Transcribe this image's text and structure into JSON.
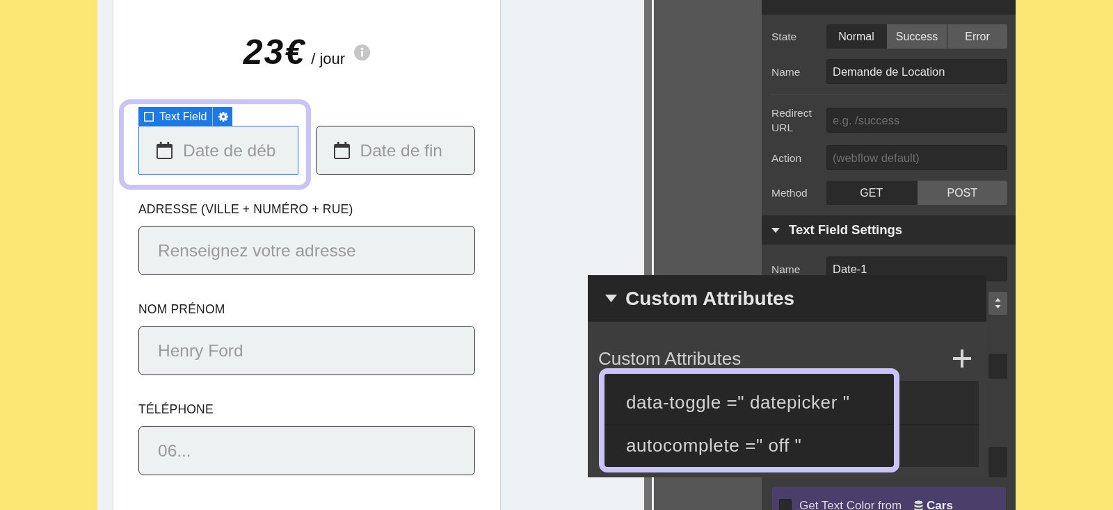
{
  "form": {
    "price": {
      "amount": "23€",
      "unit": "/ jour"
    },
    "date_fields": [
      {
        "placeholder": "Date de déb",
        "selected": true
      },
      {
        "placeholder": "Date de fin",
        "selected": false
      }
    ],
    "selection_badge": {
      "label": "Text Field"
    },
    "fields": [
      {
        "label": "ADRESSE (VILLE + NUMÉRO + RUE)",
        "placeholder": "Renseignez votre adresse"
      },
      {
        "label": "NOM PRÉNOM",
        "placeholder": "Henry Ford"
      },
      {
        "label": "TÉLÉPHONE",
        "placeholder": "06..."
      }
    ]
  },
  "settings": {
    "form_settings": {
      "groups": [
        {
          "rows": [
            {
              "kind": "segmented",
              "label": "State",
              "options": [
                {
                  "label": "Normal",
                  "selected": true
                },
                {
                  "label": "Success",
                  "selected": false
                },
                {
                  "label": "Error",
                  "selected": false
                }
              ]
            },
            {
              "kind": "input",
              "label": "Name",
              "value": "Demande de Location"
            }
          ]
        },
        {
          "rows": [
            {
              "kind": "input",
              "label": "Redirect URL",
              "placeholder": "e.g. /success"
            },
            {
              "kind": "input",
              "label": "Action",
              "placeholder": "(webflow default)"
            },
            {
              "kind": "segmented",
              "label": "Method",
              "options": [
                {
                  "label": "GET",
                  "selected": true
                },
                {
                  "label": "POST",
                  "selected": false
                }
              ]
            }
          ]
        }
      ]
    },
    "text_field_settings": {
      "title": "Text Field Settings",
      "rows": [
        {
          "kind": "input",
          "label": "Name",
          "value": "Date-1"
        }
      ]
    },
    "color_binding": {
      "checked": false,
      "label": "Get Text Color from",
      "source": "Cars"
    }
  },
  "custom_attributes": {
    "title": "Custom Attributes",
    "label": "Custom Attributes",
    "attributes": [
      "data-toggle =\" datepicker \"",
      "autocomplete =\" off \""
    ]
  }
}
